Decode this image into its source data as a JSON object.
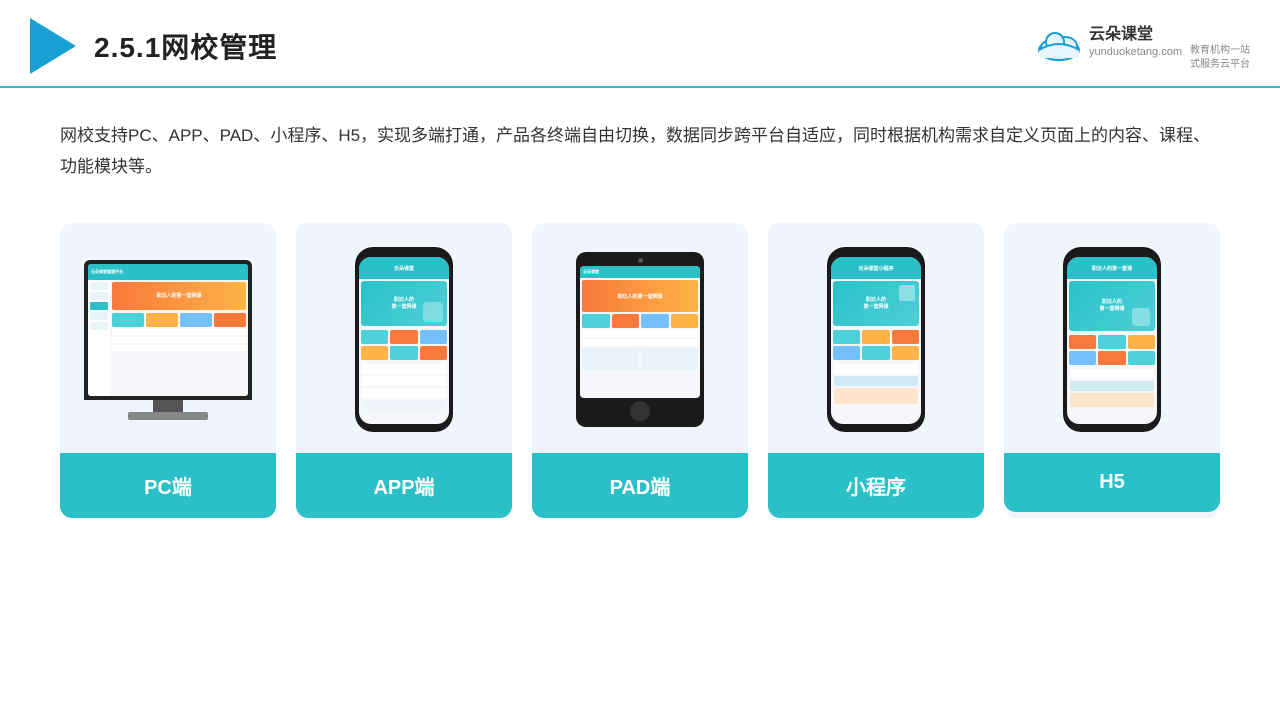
{
  "header": {
    "title": "2.5.1网校管理",
    "brand_name": "云朵课堂",
    "brand_url": "yunduoketang.com",
    "brand_tagline": "教育机构一站\n式服务云平台"
  },
  "description": "网校支持PC、APP、PAD、小程序、H5，实现多端打通，产品各终端自由切换，数据同步跨平台自适应，同时根据机构需求自定义页面上的内容、课程、功能模块等。",
  "cards": [
    {
      "id": "pc",
      "label": "PC端"
    },
    {
      "id": "app",
      "label": "APP端"
    },
    {
      "id": "pad",
      "label": "PAD端"
    },
    {
      "id": "miniprogram",
      "label": "小程序"
    },
    {
      "id": "h5",
      "label": "H5"
    }
  ]
}
